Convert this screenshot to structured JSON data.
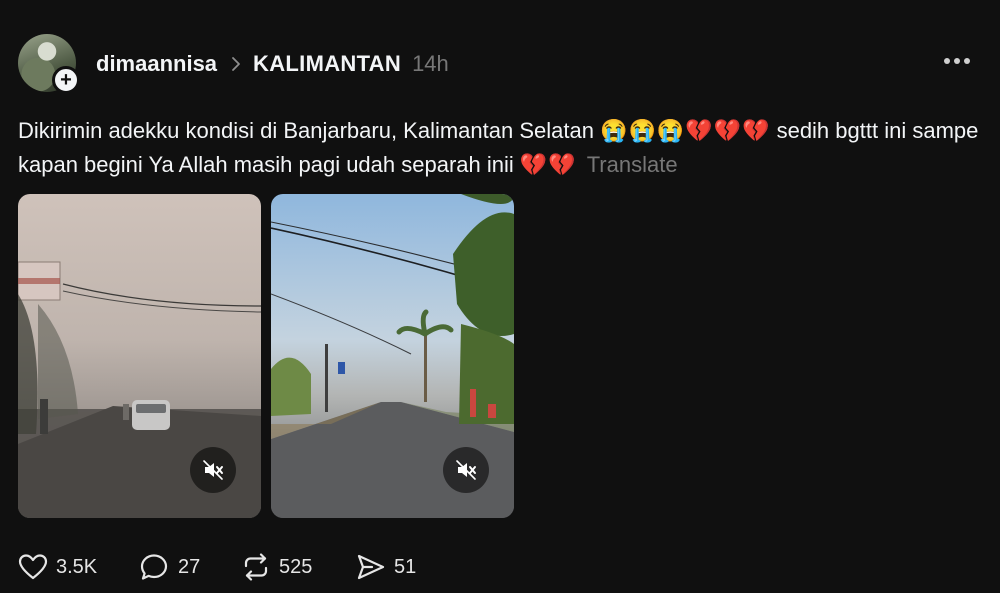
{
  "post": {
    "username": "dimaannisa",
    "topic": "KALIMANTAN",
    "time": "14h",
    "caption_text": "Dikirimin adekku kondisi di Banjarbaru, Kalimantan Selatan",
    "caption_emoji_1": "😭😭😭💔💔💔",
    "caption_text_2": "sedih bgttt ini sampe kapan begini Ya Allah masih pagi udah separah inii",
    "caption_emoji_2": "💔💔",
    "translate_label": "Translate"
  },
  "media": [
    {
      "type": "video",
      "muted": true,
      "icon": "speaker-muted-icon"
    },
    {
      "type": "video",
      "muted": true,
      "icon": "speaker-muted-icon"
    }
  ],
  "actions": {
    "likes": "3.5K",
    "comments": "27",
    "reposts": "525",
    "shares": "51"
  },
  "colors": {
    "background": "#101010",
    "text": "#f3f5f7",
    "muted_text": "#777777"
  }
}
